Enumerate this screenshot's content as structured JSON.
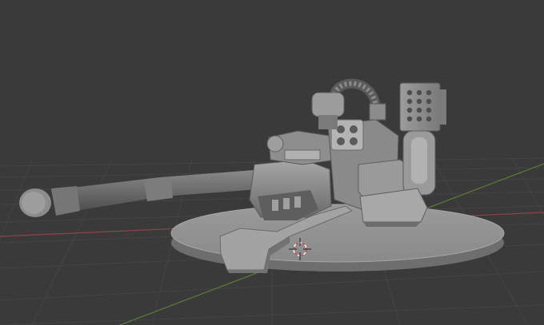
{
  "viewport": {
    "background": "#3a3a3a",
    "grid_color": "#444444",
    "x_axis_color": "#9a4a4a",
    "y_axis_color": "#6d8a3a"
  },
  "scene": {
    "model_color": "#8c8c8c",
    "cursor_icon": "3d-cursor-icon"
  }
}
